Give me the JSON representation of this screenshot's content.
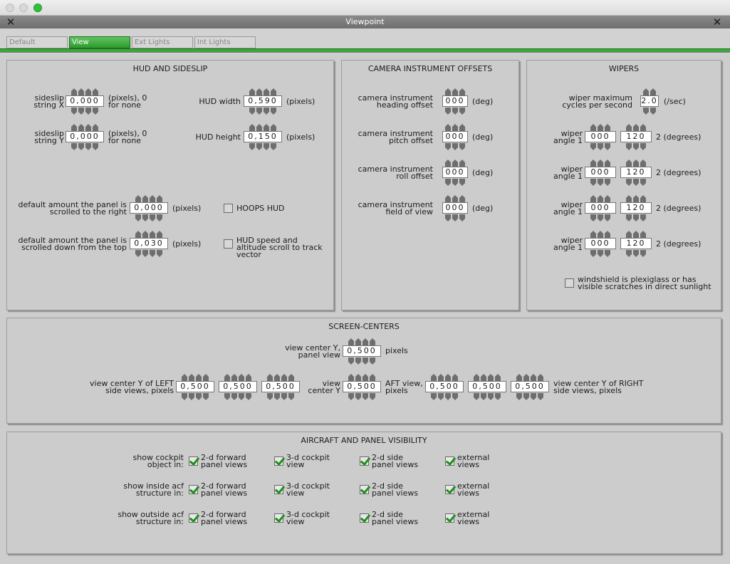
{
  "window": {
    "title": "Viewpoint"
  },
  "tabs": [
    "Default",
    "View",
    "Ext Lights",
    "Int Lights"
  ],
  "hud": {
    "title": "HUD AND SIDESLIP",
    "sideslip_x": {
      "label": "sideslip string X",
      "value": "0,000",
      "unit": "(pixels), 0 for none"
    },
    "sideslip_y": {
      "label": "sideslip string Y",
      "value": "0,000",
      "unit": "(pixels), 0 for none"
    },
    "hud_width": {
      "label": "HUD width",
      "value": "0,590",
      "unit": "(pixels)"
    },
    "hud_height": {
      "label": "HUD height",
      "value": "0,150",
      "unit": "(pixels)"
    },
    "scroll_right": {
      "label": "default amount the panel is scrolled to the right",
      "value": "0,000",
      "unit": "(pixels)"
    },
    "scroll_down": {
      "label": "default amount the panel is scrolled down from the top",
      "value": "0,030",
      "unit": "(pixels)"
    },
    "hoops_hud": "HOOPS HUD",
    "hud_speed": "HUD speed and altitude scroll to track vector"
  },
  "camera": {
    "title": "CAMERA INSTRUMENT OFFSETS",
    "heading": {
      "label": "camera instrument heading offset",
      "value": "000",
      "unit": "(deg)"
    },
    "pitch": {
      "label": "camera instrument pitch offset",
      "value": "000",
      "unit": "(deg)"
    },
    "roll": {
      "label": "camera instrument roll offset",
      "value": "000",
      "unit": "(deg)"
    },
    "fov": {
      "label": "camera instrument field of view",
      "value": "000",
      "unit": "(deg)"
    }
  },
  "wipers": {
    "title": "WIPERS",
    "max_cycles": {
      "label": "wiper maximum cycles per second",
      "value": "2.0",
      "unit": "(/sec)"
    },
    "rows": [
      {
        "label": "wiper angle 1",
        "a": "000",
        "b": "120",
        "unit": "2 (degrees)"
      },
      {
        "label": "wiper angle 1",
        "a": "000",
        "b": "120",
        "unit": "2 (degrees)"
      },
      {
        "label": "wiper angle 1",
        "a": "000",
        "b": "120",
        "unit": "2 (degrees)"
      },
      {
        "label": "wiper angle 1",
        "a": "000",
        "b": "120",
        "unit": "2 (degrees)"
      }
    ],
    "plexiglass": "windshield is plexiglass or has visible scratches in direct sunlight"
  },
  "screen": {
    "title": "SCREEN-CENTERS",
    "vc_panel": {
      "label": "view center Y, panel view",
      "value": "0,500",
      "unit": "pixels"
    },
    "left_label": "view center Y of LEFT side views, pixels",
    "left_values": [
      "0,500",
      "0,500",
      "0,500"
    ],
    "vc_label": "view center Y",
    "vc_value": "0,500",
    "aft_label": "AFT view, pixels",
    "right_values": [
      "0,500",
      "0,500",
      "0,500"
    ],
    "right_label": "view center Y of RIGHT side views, pixels"
  },
  "vis": {
    "title": "AIRCRAFT AND PANEL VISIBILITY",
    "rows": [
      "show cockpit object in:",
      "show inside acf structure in:",
      "show outside acf structure in:"
    ],
    "cols": [
      "2-d forward panel views",
      "3-d cockpit view",
      "2-d side panel views",
      "external views"
    ]
  }
}
